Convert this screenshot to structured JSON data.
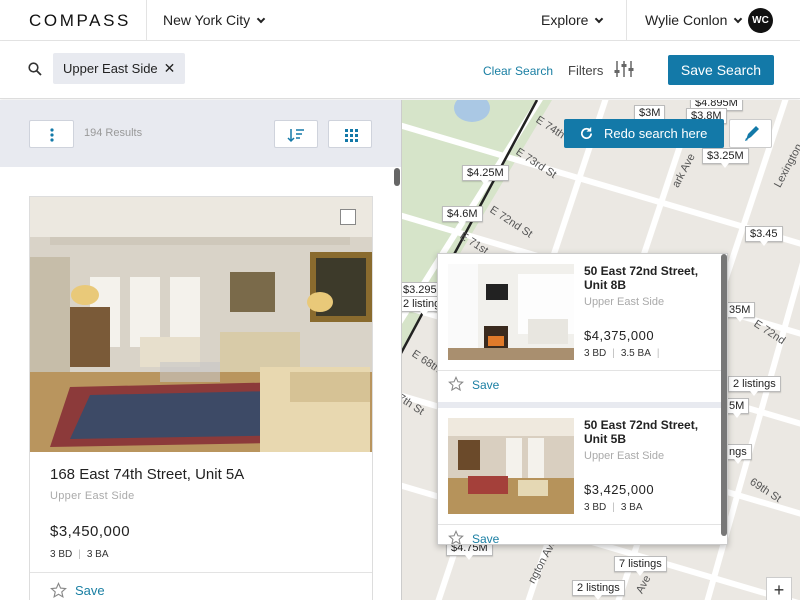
{
  "header": {
    "logo": "COMPASS",
    "city": "New York City",
    "explore": "Explore",
    "user_name": "Wylie Conlon",
    "user_initials": "WC"
  },
  "search": {
    "chip_label": "Upper East Side",
    "chip_close": "✕",
    "clear_label": "Clear Search",
    "filters_label": "Filters",
    "save_search_label": "Save Search"
  },
  "results": {
    "count_label": "194 Results"
  },
  "listing": {
    "address": "168 East 74th Street, Unit 5A",
    "neighborhood": "Upper East Side",
    "price": "$3,450,000",
    "beds": "3 BD",
    "baths": "3 BA",
    "save_label": "Save"
  },
  "map": {
    "redo_label": "Redo search here",
    "zoom_in_label": "+",
    "pins": [
      {
        "label": "$3M"
      },
      {
        "label": "$4.895M"
      },
      {
        "label": "$3.8M"
      },
      {
        "label": "$3.25M"
      },
      {
        "label": "$4.25M"
      },
      {
        "label": "$4.6M"
      },
      {
        "label": "$3.45"
      },
      {
        "label": "$3.295M"
      },
      {
        "label": "2 listings"
      },
      {
        "label": "35M"
      },
      {
        "label": "2 listings"
      },
      {
        "label": "5M"
      },
      {
        "label": "ngs"
      },
      {
        "label": "$4.75M"
      },
      {
        "label": "7 listings"
      },
      {
        "label": "2 listings"
      }
    ],
    "streets": [
      "E 74th St",
      "E 73rd St",
      "E 72nd St",
      "E 71st",
      "E 68th",
      "7th St",
      "E 72nd",
      "69th St",
      "ngton Ave",
      "ark Ave",
      "Lexington",
      "Ave"
    ]
  },
  "popup": {
    "items": [
      {
        "address": "50 East 72nd Street, Unit 8B",
        "neighborhood": "Upper East Side",
        "price": "$4,375,000",
        "beds": "3 BD",
        "baths": "3.5 BA",
        "save_label": "Save"
      },
      {
        "address": "50 East 72nd Street, Unit 5B",
        "neighborhood": "Upper East Side",
        "price": "$3,425,000",
        "beds": "3 BD",
        "baths": "3 BA",
        "save_label": "Save"
      }
    ]
  },
  "colors": {
    "brand_blue": "#1379a8",
    "link_blue": "#1a7fa3",
    "panel_gray": "#e8eaf0",
    "map_bg": "#ebe8e3"
  }
}
